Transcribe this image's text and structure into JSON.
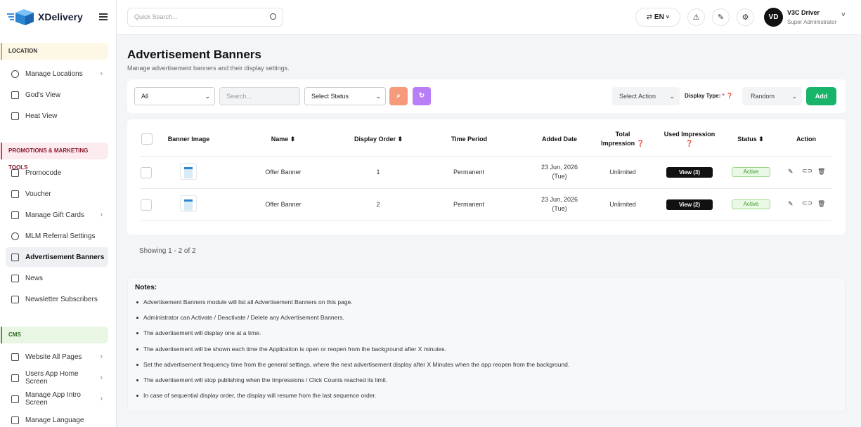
{
  "app": {
    "name": "XDelivery"
  },
  "sidebar": {
    "sections": {
      "location": "LOCATION",
      "promotions": "PROMOTIONS & MARKETING TOOLS",
      "cms": "CMS"
    },
    "items": [
      {
        "label": "Manage Locations",
        "icon": "map-pin-icon",
        "chevron": true
      },
      {
        "label": "God's View",
        "icon": "map-icon"
      },
      {
        "label": "Heat View",
        "icon": "heat-map-icon"
      },
      {
        "label": "Promocode",
        "icon": "ticket-icon"
      },
      {
        "label": "Voucher",
        "icon": "voucher-icon"
      },
      {
        "label": "Manage Gift Cards",
        "icon": "gift-icon",
        "chevron": true
      },
      {
        "label": "MLM Referral Settings",
        "icon": "network-icon"
      },
      {
        "label": "Advertisement Banners",
        "icon": "image-icon",
        "active": true
      },
      {
        "label": "News",
        "icon": "newspaper-icon"
      },
      {
        "label": "Newsletter Subscribers",
        "icon": "subscribers-icon"
      },
      {
        "label": "Website All Pages",
        "icon": "browser-icon",
        "chevron": true
      },
      {
        "label": "Users App Home Screen",
        "icon": "mobile-icon",
        "chevron": true
      },
      {
        "label": "Manage App Intro Screen",
        "icon": "mobile-screen-icon",
        "chevron": true
      },
      {
        "label": "Manage Language",
        "icon": "language-icon"
      }
    ]
  },
  "topbar": {
    "search_placeholder": "Quick Search...",
    "language": "EN",
    "user": {
      "initials": "VD",
      "name": "V3C Driver",
      "role": "Super Administrator"
    }
  },
  "page": {
    "title": "Advertisement Banners",
    "subtitle": "Manage advertisement banners and their display settings."
  },
  "filters": {
    "category": "All",
    "search_placeholder": "Search...",
    "status": "Select Status",
    "action": "Select Action",
    "display_type_label": "Display Type:",
    "display_type_required": "*",
    "display_type": "Random",
    "add_label": "Add"
  },
  "table": {
    "headers": {
      "banner_image": "Banner Image",
      "name": "Name",
      "display_order": "Display Order",
      "time_period": "Time Period",
      "added_date": "Added Date",
      "total_impression_1": "Total",
      "total_impression_2": "Impression",
      "used_impression": "Used Impression",
      "status": "Status",
      "action": "Action"
    },
    "rows": [
      {
        "name": "Offer Banner",
        "order": "1",
        "period": "Permanent",
        "date": "23 Jun, 2026",
        "day": "(Tue)",
        "total": "Unlimited",
        "used": "View (3)",
        "status": "Active"
      },
      {
        "name": "Offer Banner",
        "order": "2",
        "period": "Permanent",
        "date": "23 Jun, 2026",
        "day": "(Tue)",
        "total": "Unlimited",
        "used": "View (2)",
        "status": "Active"
      }
    ]
  },
  "pagination": {
    "showing": "Showing 1 - 2 of 2"
  },
  "notes": {
    "title": "Notes:",
    "items": [
      "Advertisement Banners module will list all Advertisement Banners on this page.",
      "Administrator can Activate / Deactivate / Delete any Advertisement Banners.",
      "The advertisement will display one at a time.",
      "The advertisement will be shown each time the Application is open or reopen from the background after X minutes.",
      "Set the advertisement frequency time from the general settings, where the next advertisement display after X Minutes when the app reopen from the background.",
      "The advertisement will stop publishing when the Impressions / Click Counts reached its limit.",
      "In case of sequential display order, the display will resume from the last sequence order."
    ]
  },
  "colors": {
    "accent_green": "#18b46a",
    "search_button": "#f59a7a",
    "reset_button": "#b87ef5"
  }
}
